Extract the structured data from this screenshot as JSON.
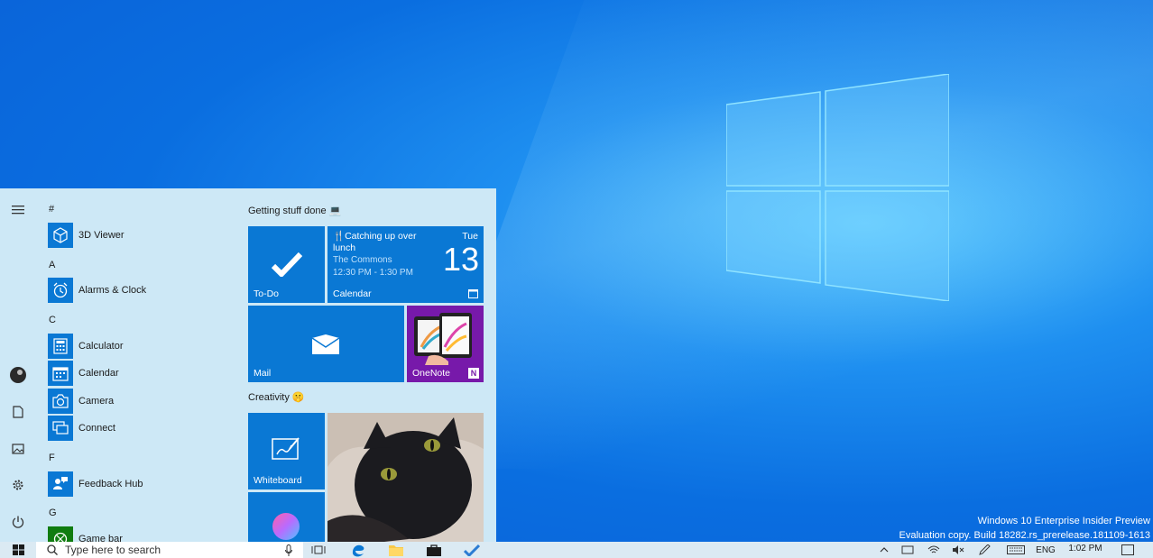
{
  "desktop": {
    "watermark_line1": "Windows 10 Enterprise Insider Preview",
    "watermark_line2": "Evaluation copy. Build 18282.rs_prerelease.181109-1613"
  },
  "start_menu": {
    "rail_icons": [
      "hamburger-menu-icon",
      "avatar",
      "document-icon",
      "pictures-icon",
      "settings-icon",
      "power-icon"
    ],
    "app_list": [
      {
        "type": "letter",
        "text": "#"
      },
      {
        "type": "app",
        "label": "3D Viewer",
        "icon": "cube-icon"
      },
      {
        "type": "letter",
        "text": "A"
      },
      {
        "type": "app",
        "label": "Alarms & Clock",
        "icon": "alarm-clock-icon"
      },
      {
        "type": "letter",
        "text": "C"
      },
      {
        "type": "app",
        "label": "Calculator",
        "icon": "calculator-icon"
      },
      {
        "type": "app",
        "label": "Calendar",
        "icon": "calendar-icon"
      },
      {
        "type": "app",
        "label": "Camera",
        "icon": "camera-icon"
      },
      {
        "type": "app",
        "label": "Connect",
        "icon": "connect-icon"
      },
      {
        "type": "letter",
        "text": "F"
      },
      {
        "type": "app",
        "label": "Feedback Hub",
        "icon": "feedback-icon"
      },
      {
        "type": "letter",
        "text": "G"
      },
      {
        "type": "app",
        "label": "Game bar",
        "icon": "xbox-icon"
      }
    ],
    "groups": [
      {
        "title": "Getting stuff done 💻"
      },
      {
        "title": "Creativity 🤫"
      }
    ],
    "tiles": {
      "todo": {
        "label": "To-Do"
      },
      "calendar": {
        "event_title": "🍴Catching up over lunch",
        "event_location": "The Commons",
        "event_time": "12:30 PM - 1:30 PM",
        "weekday": "Tue",
        "day": "13",
        "label": "Calendar"
      },
      "mail": {
        "label": "Mail"
      },
      "onenote": {
        "label": "OneNote"
      },
      "whiteboard": {
        "label": "Whiteboard"
      }
    }
  },
  "taskbar": {
    "search_placeholder": "Type here to search",
    "language": "ENG",
    "time": "1:02 PM"
  },
  "colors": {
    "accent": "#0a78d4",
    "start_bg": "#cde8f6",
    "taskbar_bg": "#dbeaf3",
    "onenote": "#7719aa"
  }
}
